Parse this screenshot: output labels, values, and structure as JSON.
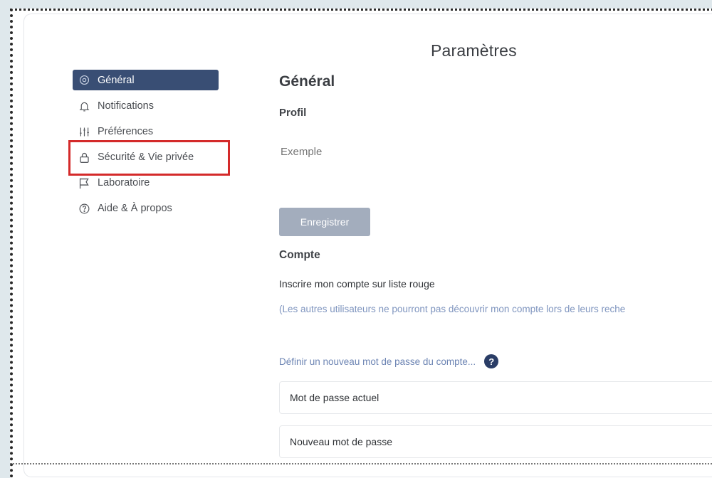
{
  "window": {
    "title": "Paramètres"
  },
  "sidebar": {
    "items": [
      {
        "label": "Général",
        "icon": "gear-icon",
        "active": true
      },
      {
        "label": "Notifications",
        "icon": "bell-icon",
        "active": false
      },
      {
        "label": "Préférences",
        "icon": "sliders-icon",
        "active": false
      },
      {
        "label": "Sécurité & Vie privée",
        "icon": "lock-icon",
        "active": false,
        "highlighted": true
      },
      {
        "label": "Laboratoire",
        "icon": "flag-icon",
        "active": false
      },
      {
        "label": "Aide & À propos",
        "icon": "help-circle-icon",
        "active": false
      }
    ]
  },
  "main": {
    "heading": "Général",
    "profile": {
      "heading": "Profil",
      "name_placeholder": "Exemple",
      "save_label": "Enregistrer"
    },
    "account": {
      "heading": "Compte",
      "blacklist_label": "Inscrire mon compte sur liste rouge",
      "blacklist_hint": "(Les autres utilisateurs ne pourront pas découvrir mon compte lors de leurs reche",
      "password_link": "Définir un nouveau mot de passe du compte...",
      "help_glyph": "?",
      "current_password_placeholder": "Mot de passe actuel",
      "new_password_placeholder": "Nouveau mot de passe"
    }
  },
  "colors": {
    "active_nav_bg": "#394e74",
    "highlight_border": "#d42a2a",
    "disabled_button": "#a3adbd",
    "hint_text": "#7f95bf"
  }
}
